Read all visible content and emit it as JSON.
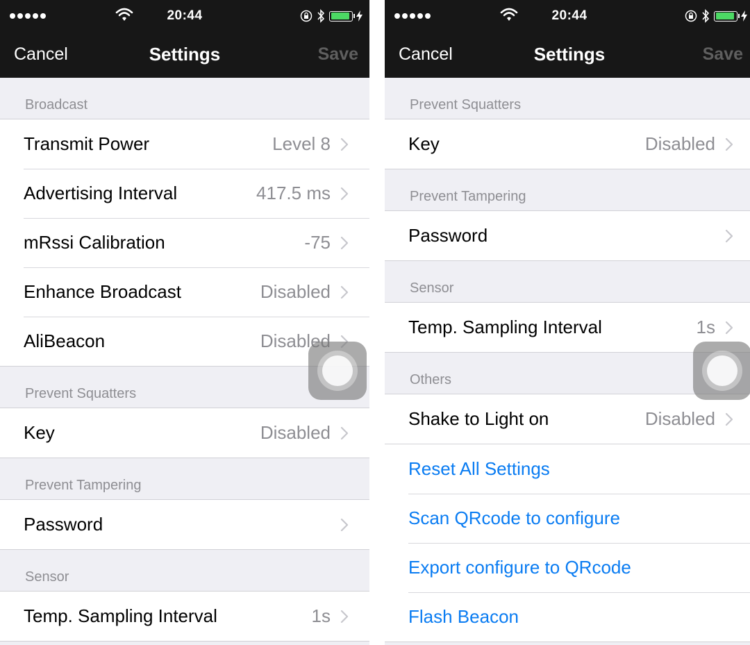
{
  "status_bar": {
    "time": "20:44"
  },
  "nav": {
    "cancel_label": "Cancel",
    "title": "Settings",
    "save_label": "Save"
  },
  "left": {
    "sections": [
      {
        "header": "Broadcast",
        "rows": [
          {
            "label": "Transmit Power",
            "value": "Level 8"
          },
          {
            "label": "Advertising Interval",
            "value": "417.5 ms"
          },
          {
            "label": "mRssi Calibration",
            "value": "-75"
          },
          {
            "label": "Enhance Broadcast",
            "value": "Disabled"
          },
          {
            "label": "AliBeacon",
            "value": "Disabled"
          }
        ]
      },
      {
        "header": "Prevent Squatters",
        "rows": [
          {
            "label": "Key",
            "value": "Disabled"
          }
        ]
      },
      {
        "header": "Prevent Tampering",
        "rows": [
          {
            "label": "Password",
            "value": ""
          }
        ]
      },
      {
        "header": "Sensor",
        "rows": [
          {
            "label": "Temp. Sampling Interval",
            "value": "1s"
          }
        ]
      }
    ]
  },
  "right": {
    "sections": [
      {
        "header": "Prevent Squatters",
        "rows": [
          {
            "label": "Key",
            "value": "Disabled"
          }
        ]
      },
      {
        "header": "Prevent Tampering",
        "rows": [
          {
            "label": "Password",
            "value": ""
          }
        ]
      },
      {
        "header": "Sensor",
        "rows": [
          {
            "label": "Temp. Sampling Interval",
            "value": "1s"
          }
        ]
      },
      {
        "header": "Others",
        "rows": [
          {
            "label": "Shake to Light on",
            "value": "Disabled"
          }
        ]
      }
    ],
    "actions": [
      "Reset All Settings",
      "Scan QRcode to configure",
      "Export configure to QRcode",
      "Flash Beacon"
    ]
  },
  "colors": {
    "nav_background": "#171717",
    "group_background": "#efeff4",
    "action_link": "#0a7cf2",
    "secondary_text": "#8e8e93",
    "battery_fill": "#4cd964"
  }
}
